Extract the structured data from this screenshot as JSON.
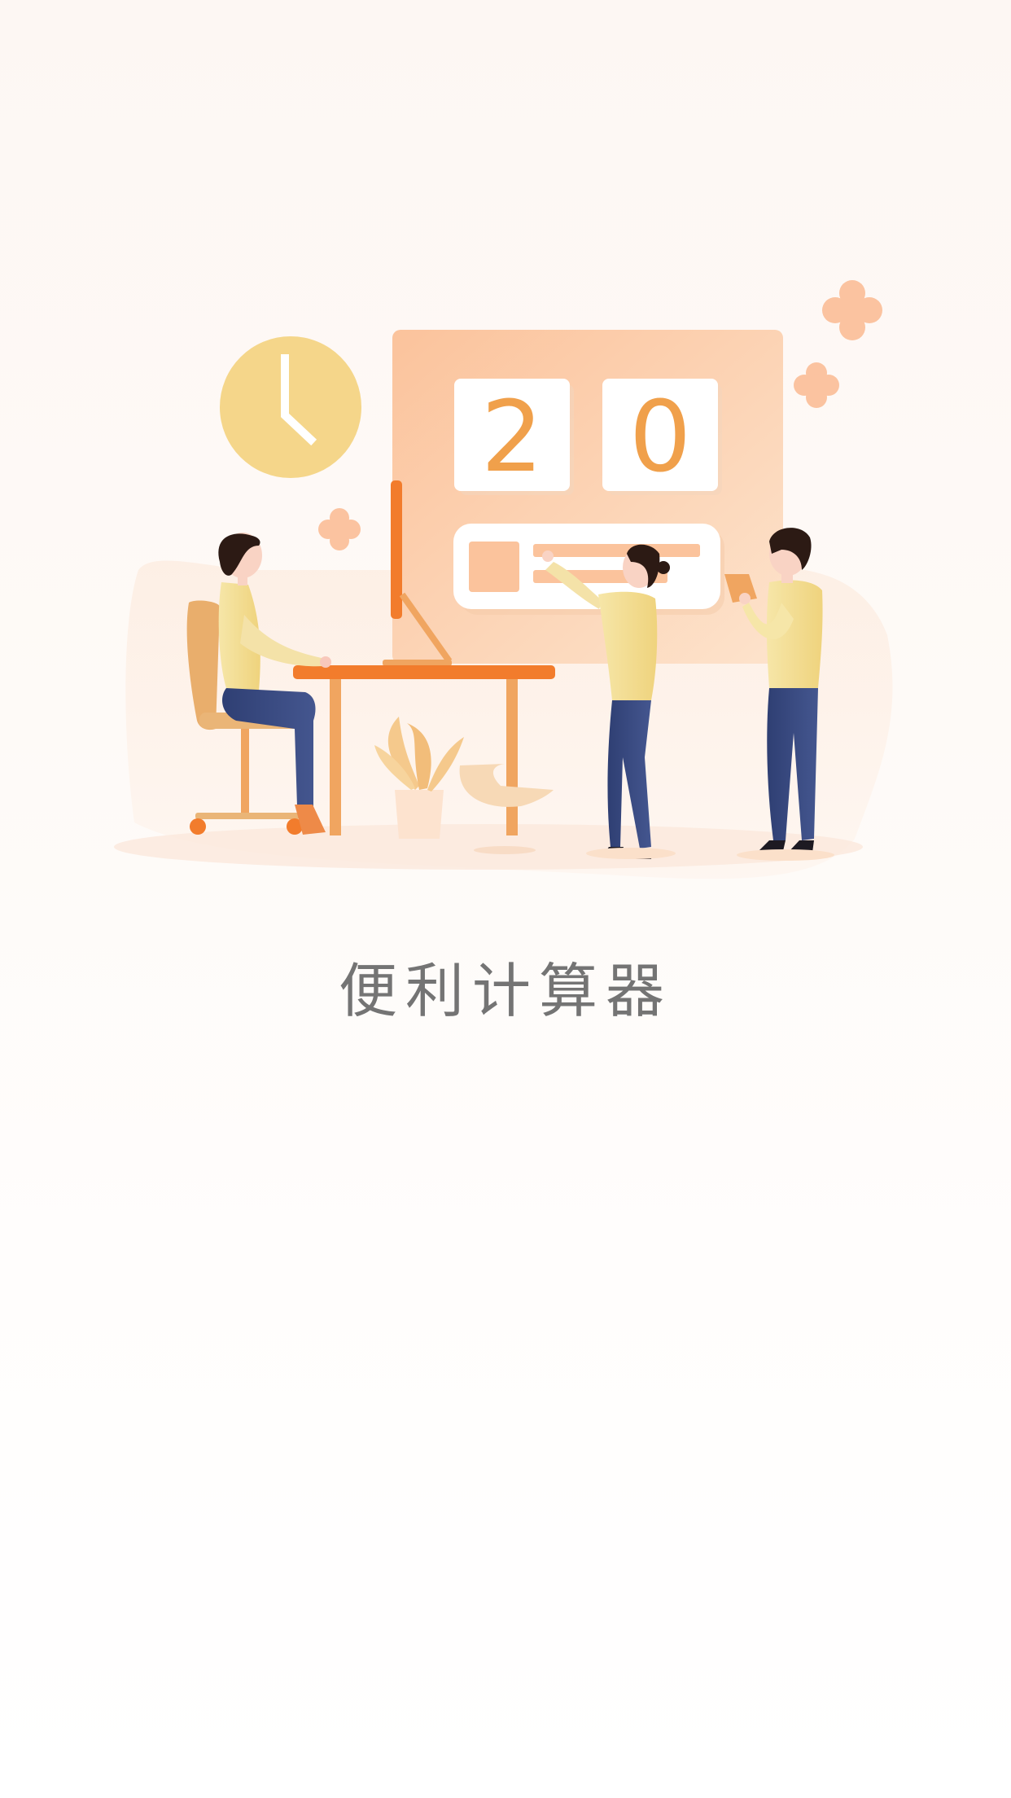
{
  "app_title": "便利计算器",
  "counter_digits": [
    "2",
    "0"
  ],
  "colors": {
    "background_top": "#fdf7f3",
    "accent_orange": "#f27c2c",
    "peach_panel": "#fbc8a2",
    "clock_yellow": "#f5d68a",
    "digit_color": "#f0a04b",
    "title_gray": "#747474"
  },
  "icons": [
    "clock-icon",
    "flower-icon"
  ]
}
